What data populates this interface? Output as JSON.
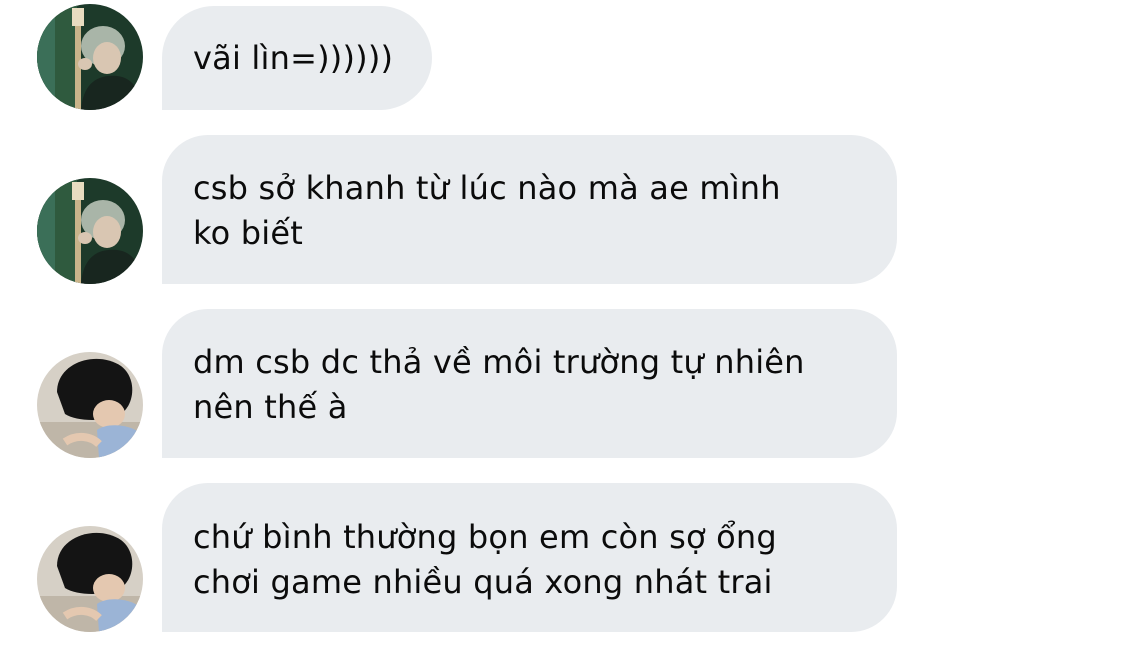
{
  "conversation": {
    "messages": [
      {
        "sender_avatar": "guitar-player-avatar-icon",
        "text": "vãi lìn=))))))"
      },
      {
        "sender_avatar": "guitar-player-avatar-icon",
        "text": "csb sở khanh từ lúc nào mà ae mình\nko biết"
      },
      {
        "sender_avatar": "dark-hair-boy-avatar-icon",
        "text": "dm csb dc thả về môi trường tự nhiên\nnên thế à"
      },
      {
        "sender_avatar": "dark-hair-boy-avatar-icon",
        "text": "chứ bình thường bọn em còn sợ ổng\nchơi game nhiều quá xong nhát trai"
      }
    ]
  },
  "colors": {
    "bubble_background": "#e9ecef",
    "text": "#0b0b0b",
    "page_background": "#ffffff"
  }
}
